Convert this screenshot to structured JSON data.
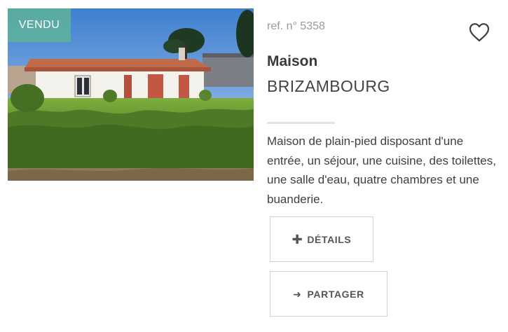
{
  "listing": {
    "status_badge": "VENDU",
    "reference": "ref. n° 5358",
    "property_type": "Maison",
    "city": "BRIZAMBOURG",
    "description": "Maison de plain-pied disposant d'une entrée, un séjour, une cuisine, des toilettes, une salle d'eau, quatre chambres et une buanderie.",
    "photo_alt": "Maison de plain-pied"
  },
  "actions": {
    "details_icon": "plus-icon",
    "details_label": "DÉTAILS",
    "share_icon": "arrow-right-icon",
    "share_label": "PARTAGER",
    "favorite_icon": "heart-outline-icon"
  },
  "colors": {
    "badge": "#5cb09e",
    "text": "#3a3a3a",
    "muted": "#9a9a9a",
    "border": "#d2d2d2"
  }
}
